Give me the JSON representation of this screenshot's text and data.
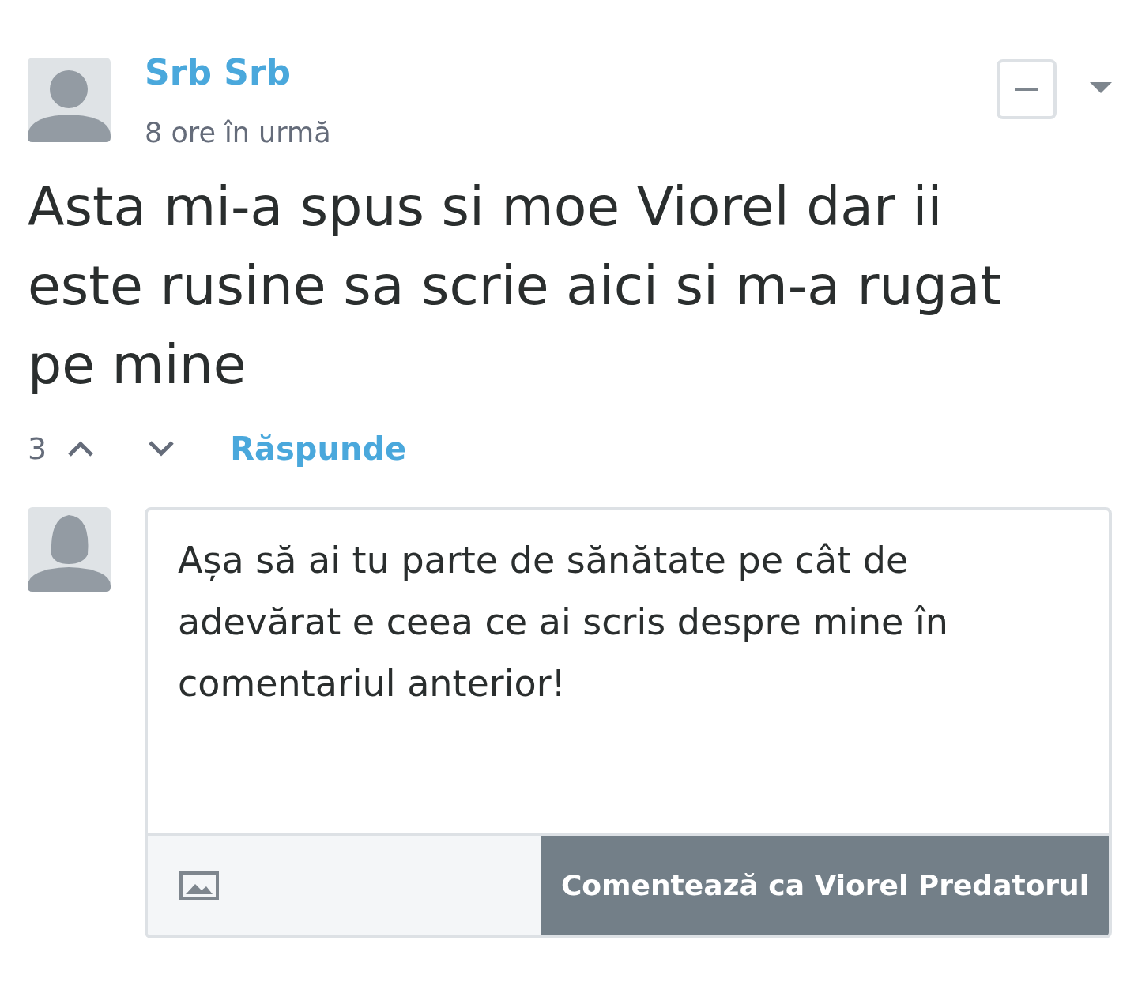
{
  "comment": {
    "author": "Srb Srb",
    "time": "8 ore în urmă",
    "text": "Asta mi-a spus si moe Viorel dar ii este rusine sa scrie aici si m-a rugat pe mine",
    "votes": "3",
    "reply_label": "Răspunde"
  },
  "reply": {
    "value": "Așa să ai tu parte de sănătate pe cât de adevărat e ceea ce ai scris despre mine în comentariul anterior!",
    "button_label": "Comentează ca Viorel Predatorul"
  }
}
